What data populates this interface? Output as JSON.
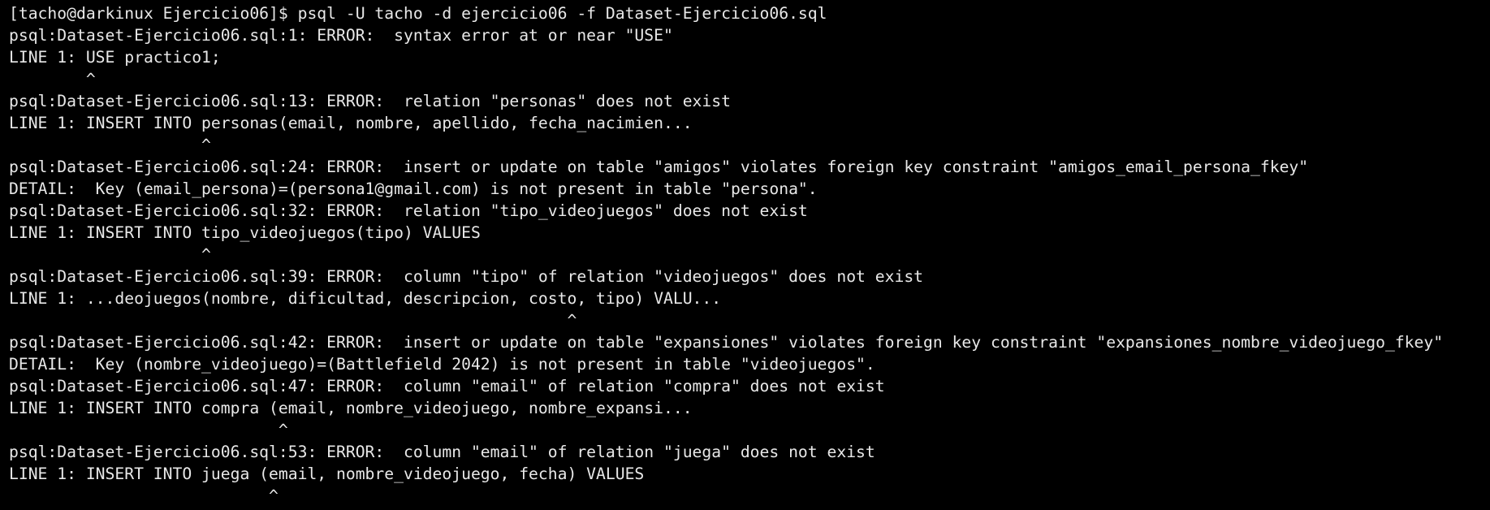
{
  "terminal": {
    "lines": [
      "[tacho@darkinux Ejercicio06]$ psql -U tacho -d ejercicio06 -f Dataset-Ejercicio06.sql",
      "psql:Dataset-Ejercicio06.sql:1: ERROR:  syntax error at or near \"USE\"",
      "LINE 1: USE practico1;",
      "        ^",
      "psql:Dataset-Ejercicio06.sql:13: ERROR:  relation \"personas\" does not exist",
      "LINE 1: INSERT INTO personas(email, nombre, apellido, fecha_nacimien...",
      "                    ^",
      "psql:Dataset-Ejercicio06.sql:24: ERROR:  insert or update on table \"amigos\" violates foreign key constraint \"amigos_email_persona_fkey\"",
      "DETAIL:  Key (email_persona)=(persona1@gmail.com) is not present in table \"persona\".",
      "psql:Dataset-Ejercicio06.sql:32: ERROR:  relation \"tipo_videojuegos\" does not exist",
      "LINE 1: INSERT INTO tipo_videojuegos(tipo) VALUES",
      "                    ^",
      "psql:Dataset-Ejercicio06.sql:39: ERROR:  column \"tipo\" of relation \"videojuegos\" does not exist",
      "LINE 1: ...deojuegos(nombre, dificultad, descripcion, costo, tipo) VALU...",
      "                                                          ^",
      "psql:Dataset-Ejercicio06.sql:42: ERROR:  insert or update on table \"expansiones\" violates foreign key constraint \"expansiones_nombre_videojuego_fkey\"",
      "DETAIL:  Key (nombre_videojuego)=(Battlefield 2042) is not present in table \"videojuegos\".",
      "psql:Dataset-Ejercicio06.sql:47: ERROR:  column \"email\" of relation \"compra\" does not exist",
      "LINE 1: INSERT INTO compra (email, nombre_videojuego, nombre_expansi...",
      "                            ^",
      "psql:Dataset-Ejercicio06.sql:53: ERROR:  column \"email\" of relation \"juega\" does not exist",
      "LINE 1: INSERT INTO juega (email, nombre_videojuego, fecha) VALUES",
      "                           ^"
    ]
  }
}
